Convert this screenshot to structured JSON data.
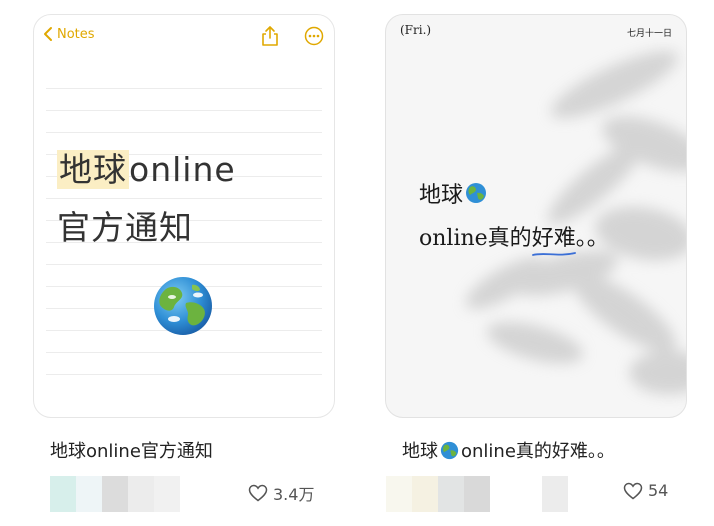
{
  "posts": [
    {
      "notes_back_label": "Notes",
      "note_line1_highlight": "地球",
      "note_line1_rest": "online",
      "note_line2": "官方通知",
      "caption": "地球online官方通知",
      "likes": "3.4万"
    },
    {
      "day_label": "(Fri.)",
      "date_label": "七月十一日",
      "poem_line1": "地球",
      "poem_line2_before": "online真的",
      "poem_line2_underlined": "好难",
      "poem_line2_after": "。。",
      "caption_before": "地球",
      "caption_after": "online真的好难。。",
      "likes": "54"
    }
  ],
  "colors": {
    "accent_yellow": "#e0a800",
    "highlight": "#fbeec4",
    "underline_blue": "#3b6fd6"
  },
  "icons": [
    "back-chevron-icon",
    "share-icon",
    "more-icon",
    "globe-icon",
    "heart-icon"
  ]
}
